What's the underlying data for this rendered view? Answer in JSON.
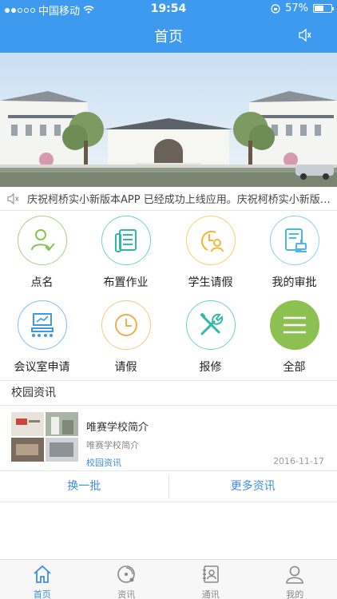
{
  "status_bar": {
    "carrier": "中国移动",
    "time": "19:54",
    "battery": "57%",
    "battery_level": 0.57
  },
  "navbar": {
    "title": "首页"
  },
  "notice": {
    "text": "庆祝柯桥实小新版本APP 已经成功上线应用。庆祝柯桥实小新版本A..."
  },
  "grid": [
    {
      "label": "点名",
      "icon": "person-check-icon",
      "color": "#8cc152"
    },
    {
      "label": "布置作业",
      "icon": "homework-icon",
      "color": "#2eb8a6"
    },
    {
      "label": "学生请假",
      "icon": "clock-person-icon",
      "color": "#f2b632"
    },
    {
      "label": "我的审批",
      "icon": "approval-stamp-icon",
      "color": "#4fb6e3"
    },
    {
      "label": "会议室申请",
      "icon": "meeting-room-icon",
      "color": "#3d9ae0"
    },
    {
      "label": "请假",
      "icon": "clock-icon",
      "color": "#f0ad4e"
    },
    {
      "label": "报修",
      "icon": "tools-icon",
      "color": "#2eb8a6"
    },
    {
      "label": "全部",
      "icon": "menu-icon",
      "color": "#8cc152"
    }
  ],
  "section": {
    "title": "校园资讯"
  },
  "news": [
    {
      "title": "唯赛学校简介",
      "subtitle": "唯赛学校简介",
      "tag": "校园资讯",
      "date": "2016-11-17"
    }
  ],
  "actions": {
    "refresh": "换一批",
    "more": "更多资讯"
  },
  "tabbar": [
    {
      "label": "首页",
      "icon": "home-icon",
      "active": true
    },
    {
      "label": "资讯",
      "icon": "news-icon",
      "active": false
    },
    {
      "label": "通讯",
      "icon": "contacts-icon",
      "active": false
    },
    {
      "label": "我的",
      "icon": "profile-icon",
      "active": false
    }
  ]
}
